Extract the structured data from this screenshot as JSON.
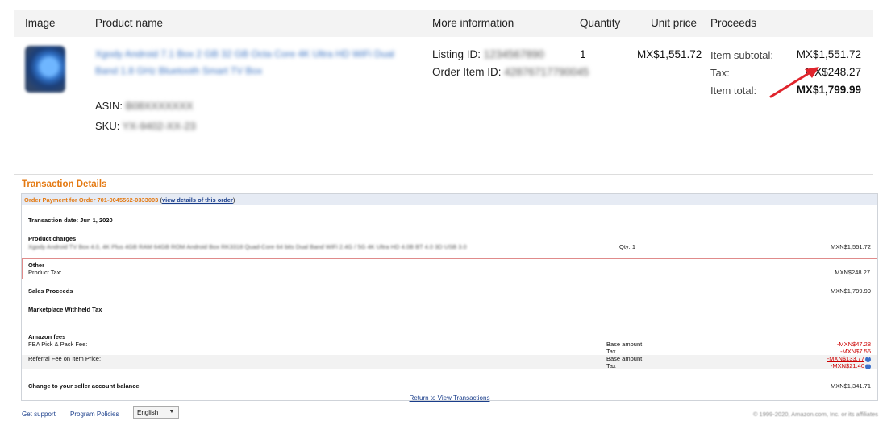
{
  "order_table": {
    "headers": {
      "image": "Image",
      "product_name": "Product name",
      "more_information": "More information",
      "quantity": "Quantity",
      "unit_price": "Unit price",
      "proceeds": "Proceeds"
    },
    "product": {
      "name_blurred": "Xgody Android 7.1 Box 2 GB 32 GB Octa Core 4K Ultra HD WiFi Dual Band 1.8 GHz Bluetooth Smart TV Box",
      "asin_label": "ASIN:",
      "asin_value": "B08XXXXXXX",
      "sku_label": "SKU:",
      "sku_value": "YX-9402-XX-23"
    },
    "more_info": {
      "listing_id_label": "Listing ID:",
      "listing_id_value": "1234567890",
      "order_item_id_label": "Order Item ID:",
      "order_item_id_value": "42876717790045"
    },
    "quantity": "1",
    "unit_price": "MX$1,551.72",
    "proceeds": {
      "subtotal_label": "Item subtotal:",
      "subtotal_value": "MX$1,551.72",
      "tax_label": "Tax:",
      "tax_value": "MX$248.27",
      "total_label": "Item total:",
      "total_value": "MX$1,799.99"
    },
    "annotation_color": "#e0242c"
  },
  "transaction_details": {
    "title": "Transaction Details",
    "order_payment": "Order Payment for Order 701-0045562-0333003",
    "view_link": "view details of this order",
    "transaction_date": "Transaction date: Jun 1, 2020",
    "product_charges_label": "Product charges",
    "product_desc_blurred": "Xgody Android TV Box 4.0, 4K Plus 4GB RAM 64GB ROM Android Box RK3318 Quad-Core 64 bits Dual Band WiFi 2.4G / 5G 4K Ultra HD 4.0B BT 4.0 3D USB 3.0",
    "qty_text": "Qty: 1",
    "product_charges_amount": "MXN$1,551.72",
    "other_label": "Other",
    "product_tax_label": "Product Tax:",
    "product_tax_amount": "MXN$248.27",
    "sales_proceeds_label": "Sales Proceeds",
    "sales_proceeds_amount": "MXN$1,799.99",
    "withheld_label": "Marketplace Withheld Tax",
    "amazon_fees_label": "Amazon fees",
    "fba_label": "FBA Pick & Pack Fee:",
    "base_amount_label": "Base amount",
    "tax_label": "Tax",
    "fba_base_amount": "-MXN$47.28",
    "fba_tax_amount": "-MXN$7.56",
    "referral_label": "Referral Fee on Item Price:",
    "referral_base_amount": "-MXN$133.77",
    "referral_tax_amount": "-MXN$21.40",
    "balance_label": "Change to your seller account balance",
    "balance_amount": "MXN$1,341.71",
    "return_link": "Return to View Transactions"
  },
  "footer": {
    "get_support": "Get support",
    "program_policies": "Program Policies",
    "language": "English",
    "copyright": "© 1999-2020, Amazon.com, Inc. or its affiliates"
  }
}
